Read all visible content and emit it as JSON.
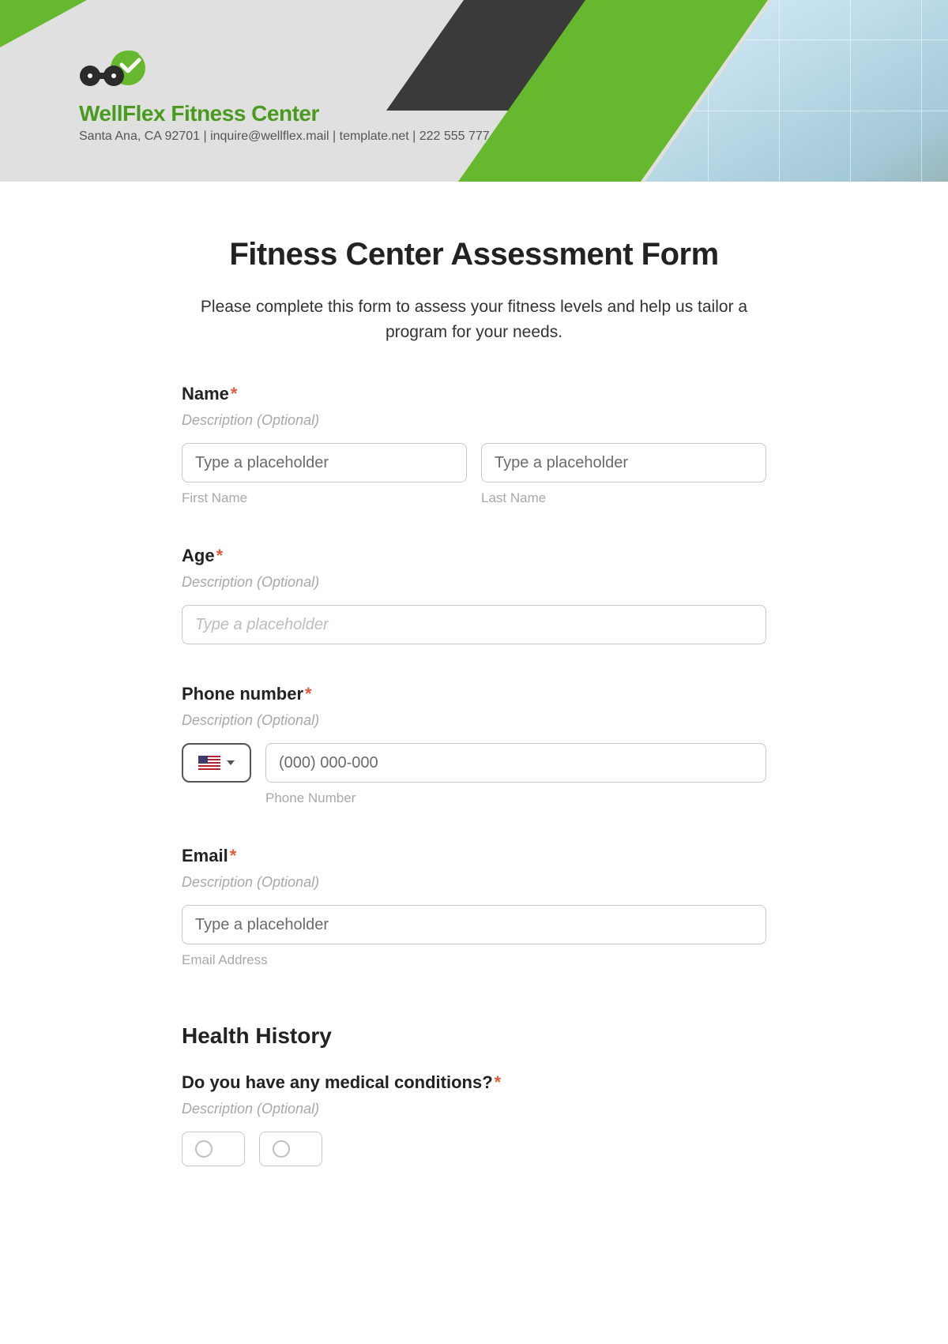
{
  "brand": {
    "name": "WellFlex Fitness Center",
    "tagline": "Santa Ana, CA 92701 | inquire@wellflex.mail | template.net | 222 555 777"
  },
  "form": {
    "title": "Fitness Center Assessment Form",
    "intro": "Please complete this form to assess your fitness levels and help us tailor a program for your needs.",
    "desc_placeholder": "Description (Optional)",
    "input_placeholder": "Type a placeholder",
    "name": {
      "label": "Name",
      "first_sub": "First Name",
      "last_sub": "Last Name"
    },
    "age": {
      "label": "Age"
    },
    "phone": {
      "label": "Phone number",
      "placeholder": "(000) 000-000",
      "sub": "Phone Number"
    },
    "email": {
      "label": "Email",
      "sub": "Email Address"
    },
    "health": {
      "heading": "Health History",
      "q1": "Do you have any medical conditions?"
    }
  }
}
